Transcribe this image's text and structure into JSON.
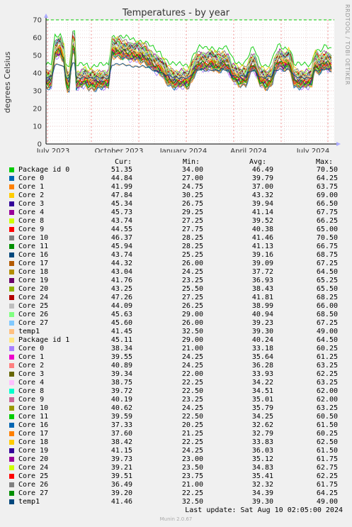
{
  "title": "Temperatures - by year",
  "side_label": "RRDTOOL / TOBI OETIKER",
  "footer": "Munin 2.0.67",
  "last_update": "Last update: Sat Aug 10 02:05:00 2024",
  "columns": [
    "Cur:",
    "Min:",
    "Avg:",
    "Max:"
  ],
  "chart_data": {
    "type": "line",
    "title": "Temperatures - by year",
    "ylabel": "degrees Celsius",
    "ylim": [
      0,
      70
    ],
    "yticks": [
      0,
      10,
      20,
      30,
      40,
      50,
      60,
      70
    ],
    "xticks": [
      "July 2023",
      "October 2023",
      "January 2024",
      "April 2024",
      "July 2024"
    ],
    "warning_line": 70,
    "grid": true,
    "series": [
      {
        "name": "Package id 0",
        "color": "#00cc00",
        "cur": "51.35",
        "min": "34.00",
        "avg": "46.49",
        "max": "70.50"
      },
      {
        "name": "Core 0",
        "color": "#0066b3",
        "cur": "44.84",
        "min": "27.00",
        "avg": "39.79",
        "max": "64.25"
      },
      {
        "name": "Core 1",
        "color": "#ff8000",
        "cur": "41.99",
        "min": "24.75",
        "avg": "37.00",
        "max": "63.75"
      },
      {
        "name": "Core 2",
        "color": "#ffcc00",
        "cur": "47.84",
        "min": "30.25",
        "avg": "43.32",
        "max": "69.00"
      },
      {
        "name": "Core 3",
        "color": "#330099",
        "cur": "45.34",
        "min": "26.75",
        "avg": "39.94",
        "max": "66.50"
      },
      {
        "name": "Core 4",
        "color": "#990099",
        "cur": "45.73",
        "min": "29.25",
        "avg": "41.14",
        "max": "67.75"
      },
      {
        "name": "Core 8",
        "color": "#ccff00",
        "cur": "43.74",
        "min": "27.25",
        "avg": "39.52",
        "max": "66.25"
      },
      {
        "name": "Core 9",
        "color": "#ff0000",
        "cur": "44.55",
        "min": "27.75",
        "avg": "40.38",
        "max": "65.00"
      },
      {
        "name": "Core 10",
        "color": "#808080",
        "cur": "46.37",
        "min": "28.25",
        "avg": "41.46",
        "max": "70.50"
      },
      {
        "name": "Core 11",
        "color": "#008f00",
        "cur": "45.94",
        "min": "28.25",
        "avg": "41.13",
        "max": "66.75"
      },
      {
        "name": "Core 16",
        "color": "#00487d",
        "cur": "43.74",
        "min": "25.25",
        "avg": "39.16",
        "max": "68.75"
      },
      {
        "name": "Core 17",
        "color": "#b35a00",
        "cur": "44.32",
        "min": "26.00",
        "avg": "39.09",
        "max": "67.25"
      },
      {
        "name": "Core 18",
        "color": "#b38f00",
        "cur": "43.04",
        "min": "24.25",
        "avg": "37.72",
        "max": "64.50"
      },
      {
        "name": "Core 19",
        "color": "#6b006b",
        "cur": "41.76",
        "min": "23.25",
        "avg": "36.93",
        "max": "65.25"
      },
      {
        "name": "Core 20",
        "color": "#8fb300",
        "cur": "43.25",
        "min": "25.50",
        "avg": "38.43",
        "max": "65.50"
      },
      {
        "name": "Core 24",
        "color": "#b30000",
        "cur": "47.26",
        "min": "27.25",
        "avg": "41.81",
        "max": "68.25"
      },
      {
        "name": "Core 25",
        "color": "#bebebe",
        "cur": "44.09",
        "min": "26.25",
        "avg": "38.99",
        "max": "66.00"
      },
      {
        "name": "Core 26",
        "color": "#80ff80",
        "cur": "45.63",
        "min": "29.00",
        "avg": "40.94",
        "max": "68.50"
      },
      {
        "name": "Core 27",
        "color": "#80c9ff",
        "cur": "45.60",
        "min": "26.00",
        "avg": "39.23",
        "max": "67.25"
      },
      {
        "name": "temp1",
        "color": "#ffc080",
        "cur": "41.45",
        "min": "32.50",
        "avg": "39.30",
        "max": "49.00"
      },
      {
        "name": "Package id 1",
        "color": "#ffe680",
        "cur": "45.11",
        "min": "29.00",
        "avg": "40.24",
        "max": "64.50"
      },
      {
        "name": "Core 0",
        "color": "#aa80ff",
        "cur": "38.34",
        "min": "21.00",
        "avg": "33.18",
        "max": "60.25"
      },
      {
        "name": "Core 1",
        "color": "#ee00cc",
        "cur": "39.55",
        "min": "24.25",
        "avg": "35.64",
        "max": "61.25"
      },
      {
        "name": "Core 2",
        "color": "#ff8080",
        "cur": "40.89",
        "min": "24.25",
        "avg": "36.28",
        "max": "63.25"
      },
      {
        "name": "Core 3",
        "color": "#666600",
        "cur": "39.34",
        "min": "22.00",
        "avg": "33.93",
        "max": "62.25"
      },
      {
        "name": "Core 4",
        "color": "#ffbfff",
        "cur": "38.75",
        "min": "22.25",
        "avg": "34.22",
        "max": "63.25"
      },
      {
        "name": "Core 8",
        "color": "#00ffcc",
        "cur": "39.72",
        "min": "22.50",
        "avg": "34.51",
        "max": "62.00"
      },
      {
        "name": "Core 9",
        "color": "#cc6699",
        "cur": "40.19",
        "min": "23.25",
        "avg": "35.01",
        "max": "62.00"
      },
      {
        "name": "Core 10",
        "color": "#999900",
        "cur": "40.62",
        "min": "24.25",
        "avg": "35.79",
        "max": "63.25"
      },
      {
        "name": "Core 11",
        "color": "#00cc00",
        "cur": "39.59",
        "min": "22.50",
        "avg": "34.25",
        "max": "60.50"
      },
      {
        "name": "Core 16",
        "color": "#0066b3",
        "cur": "37.33",
        "min": "20.25",
        "avg": "32.62",
        "max": "61.50"
      },
      {
        "name": "Core 17",
        "color": "#ff8000",
        "cur": "37.60",
        "min": "21.25",
        "avg": "32.79",
        "max": "60.25"
      },
      {
        "name": "Core 18",
        "color": "#ffcc00",
        "cur": "38.42",
        "min": "22.25",
        "avg": "33.83",
        "max": "62.50"
      },
      {
        "name": "Core 19",
        "color": "#330099",
        "cur": "41.15",
        "min": "24.25",
        "avg": "36.03",
        "max": "61.50"
      },
      {
        "name": "Core 20",
        "color": "#990099",
        "cur": "39.73",
        "min": "23.00",
        "avg": "35.12",
        "max": "61.75"
      },
      {
        "name": "Core 24",
        "color": "#ccff00",
        "cur": "39.21",
        "min": "23.50",
        "avg": "34.83",
        "max": "62.75"
      },
      {
        "name": "Core 25",
        "color": "#ff0000",
        "cur": "39.51",
        "min": "23.75",
        "avg": "35.41",
        "max": "62.25"
      },
      {
        "name": "Core 26",
        "color": "#808080",
        "cur": "36.49",
        "min": "21.00",
        "avg": "32.32",
        "max": "61.75"
      },
      {
        "name": "Core 27",
        "color": "#008f00",
        "cur": "39.20",
        "min": "22.25",
        "avg": "34.39",
        "max": "64.25"
      },
      {
        "name": "temp1",
        "color": "#00487d",
        "cur": "41.46",
        "min": "32.50",
        "avg": "39.30",
        "max": "49.00"
      }
    ]
  }
}
